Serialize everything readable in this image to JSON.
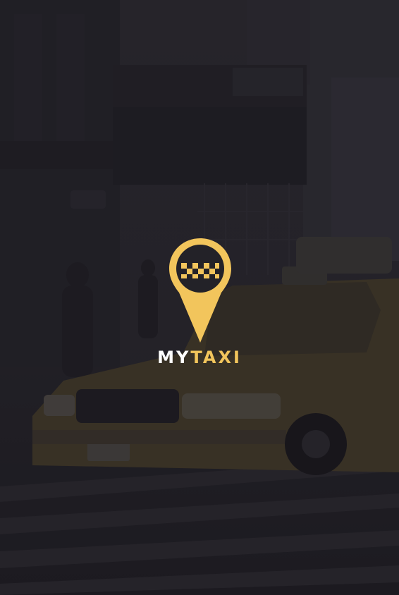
{
  "splash": {
    "brand_prefix": "MY",
    "brand_suffix": "TAXI"
  },
  "icons": {
    "logo": "location-pin-taxi-icon"
  },
  "colors": {
    "accent": "#f2c55c",
    "brand_text": "#ffffff",
    "overlay": "#1f1e24"
  }
}
